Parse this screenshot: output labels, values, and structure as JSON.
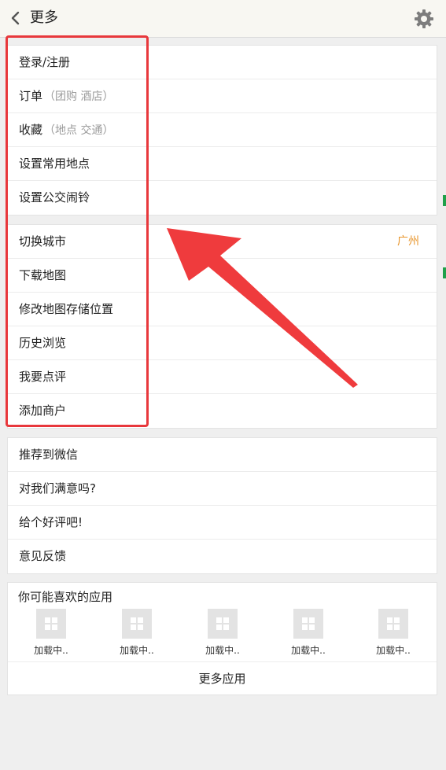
{
  "header": {
    "title": "更多"
  },
  "group1": [
    {
      "label": "登录/注册",
      "sub": ""
    },
    {
      "label": "订单",
      "sub": "（团购  酒店）"
    },
    {
      "label": "收藏",
      "sub": "（地点  交通）"
    },
    {
      "label": "设置常用地点",
      "sub": ""
    },
    {
      "label": "设置公交闹铃",
      "sub": ""
    }
  ],
  "group2": [
    {
      "label": "切换城市",
      "value": "广州"
    },
    {
      "label": "下载地图",
      "value": ""
    },
    {
      "label": "修改地图存储位置",
      "value": ""
    },
    {
      "label": "历史浏览",
      "value": ""
    },
    {
      "label": "我要点评",
      "value": ""
    },
    {
      "label": "添加商户",
      "value": ""
    }
  ],
  "group3": [
    {
      "label": "推荐到微信"
    },
    {
      "label": "对我们满意吗?"
    },
    {
      "label": "给个好评吧!"
    },
    {
      "label": "意见反馈"
    }
  ],
  "apps": {
    "title": "你可能喜欢的应用",
    "items": [
      {
        "label": "加载中.."
      },
      {
        "label": "加载中.."
      },
      {
        "label": "加载中.."
      },
      {
        "label": "加载中.."
      },
      {
        "label": "加载中.."
      }
    ],
    "more_label": "更多应用"
  },
  "colors": {
    "highlight": "#e8383c",
    "city_value": "#e8952b",
    "header_bg": "#f8f7f2"
  }
}
